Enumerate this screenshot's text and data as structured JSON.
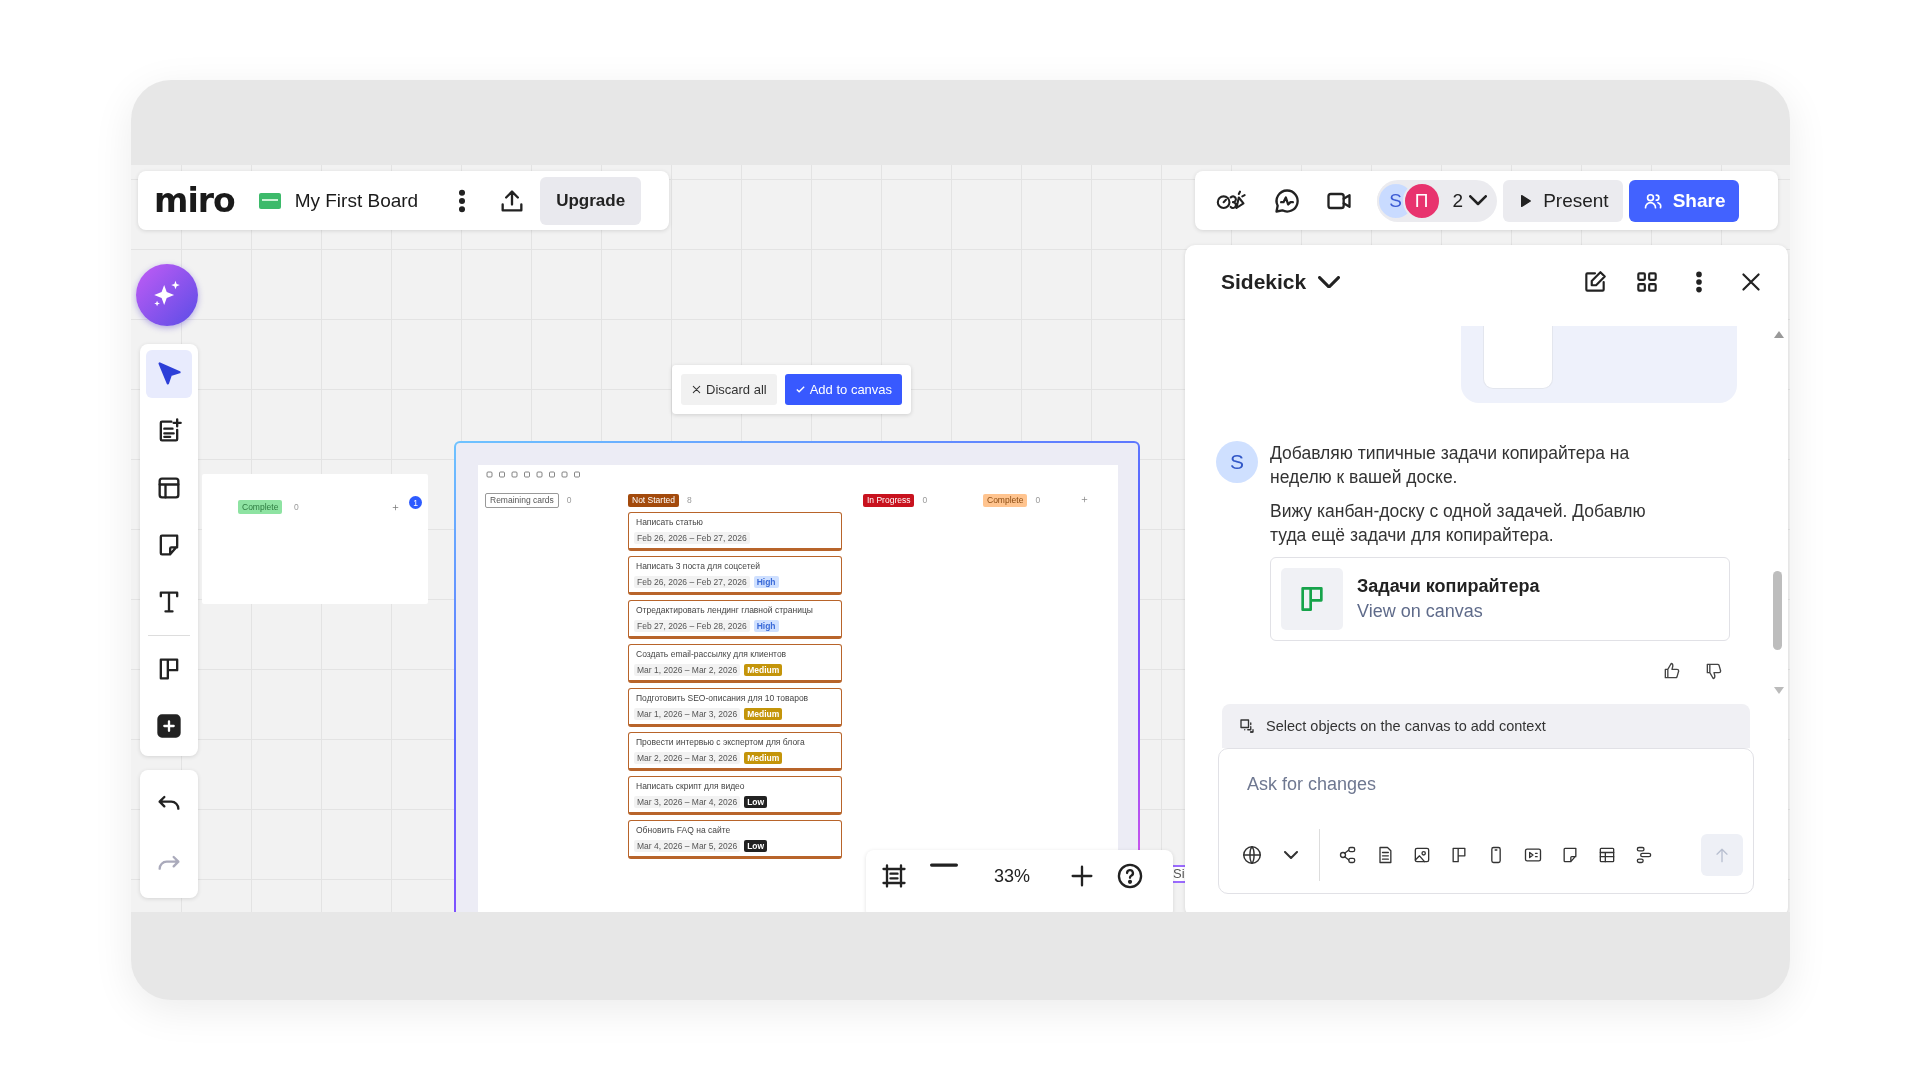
{
  "header": {
    "logo": "miro",
    "board_name": "My First Board",
    "upgrade": "Upgrade"
  },
  "collab": {
    "avatars": [
      {
        "initial": "S",
        "color": "#c9dbff"
      },
      {
        "initial": "П",
        "color": "#e8336e"
      }
    ],
    "user_count": "2",
    "present": "Present",
    "share": "Share"
  },
  "toolbar": {
    "tools": [
      {
        "kind": "select",
        "selected": true
      },
      {
        "kind": "templates",
        "selected": false
      },
      {
        "kind": "layout",
        "selected": false
      },
      {
        "kind": "sticky",
        "selected": false
      },
      {
        "kind": "text",
        "selected": false
      }
    ],
    "more_tools": [
      {
        "kind": "kanban",
        "selected": false
      },
      {
        "kind": "add",
        "selected": false
      }
    ],
    "history": [
      {
        "kind": "undo",
        "disabled": false
      },
      {
        "kind": "redo",
        "disabled": true
      }
    ]
  },
  "canvas": {
    "proposal": {
      "discard": "Discard all",
      "add": "Add to canvas"
    },
    "side_card": {
      "status": "Complete",
      "count": "0",
      "badge": "1"
    },
    "kanban": {
      "columns": [
        {
          "title": "Remaining cards",
          "count": "0",
          "color": "#ffffff"
        },
        {
          "title": "Not Started",
          "count": "8",
          "color": "#a34a0c"
        },
        {
          "title": "In Progress",
          "count": "0",
          "color": "#c8121e"
        },
        {
          "title": "Complete",
          "count": "0",
          "color": "#ffc48f"
        }
      ],
      "cards": [
        {
          "title": "Написать статью",
          "dates": "Feb 26, 2026 – Feb 27, 2026"
        },
        {
          "title": "Написать 3 поста для соцсетей",
          "dates": "Feb 26, 2026 – Feb 27, 2026",
          "priority": {
            "label": "High",
            "color": "#cfe0ff"
          }
        },
        {
          "title": "Отредактировать лендинг главной страницы",
          "dates": "Feb 27, 2026 – Feb 28, 2026",
          "priority": {
            "label": "High",
            "color": "#cfe0ff"
          }
        },
        {
          "title": "Создать email-рассылку для клиентов",
          "dates": "Mar 1, 2026 – Mar 2, 2026",
          "priority": {
            "label": "Medium",
            "color": "#c4950a"
          }
        },
        {
          "title": "Подготовить SEO-описания для 10 товаров",
          "dates": "Mar 1, 2026 – Mar 3, 2026",
          "priority": {
            "label": "Medium",
            "color": "#c4950a"
          }
        },
        {
          "title": "Провести интервью с экспертом для блога",
          "dates": "Mar 2, 2026 – Mar 3, 2026",
          "priority": {
            "label": "Medium",
            "color": "#c4950a"
          }
        },
        {
          "title": "Написать скрипт для видео",
          "dates": "Mar 3, 2026 – Mar 4, 2026",
          "priority": {
            "label": "Low",
            "color": "#222222"
          }
        },
        {
          "title": "Обновить FAQ на сайте",
          "dates": "Mar 4, 2026 – Mar 5, 2026",
          "priority": {
            "label": "Low",
            "color": "#222222"
          }
        }
      ]
    },
    "partial_label": "Si"
  },
  "sidekick": {
    "title": "Sidekick",
    "avatar": "S",
    "paragraphs": [
      "Добавляю типичные задачи копирайтера на неделю к вашей доске.",
      "Вижу канбан-доску с одной задачей. Добавлю туда ещё задачи для копирайтера."
    ],
    "result": {
      "title": "Задачи копирайтера",
      "link": "View on canvas"
    },
    "context_hint": "Select objects on the canvas to add context",
    "input": {
      "placeholder": "Ask for changes"
    },
    "send": {
      "disabled": true
    }
  },
  "zoom": {
    "level_text": "33%"
  }
}
